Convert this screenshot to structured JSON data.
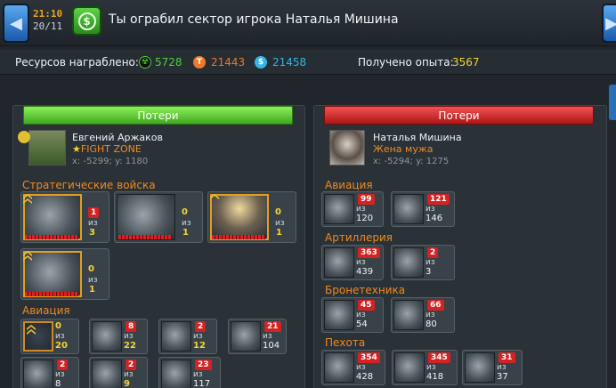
{
  "header": {
    "time": "21:10",
    "date": "20/11",
    "title": "Ты ограбил сектор игрока Наталья Мишина"
  },
  "resources": {
    "label": "Ресурсов награблено:",
    "items": [
      {
        "icon": "radiation-icon",
        "value": "5728",
        "color": "#4fcf3a"
      },
      {
        "icon": "t-coin-icon",
        "value": "21443",
        "color": "#f0782a"
      },
      {
        "icon": "dollar-icon",
        "value": "21458",
        "color": "#35b5e8"
      }
    ],
    "exp_label": "Получено опыта:",
    "exp_value": "3567"
  },
  "left": {
    "header": "Потери",
    "player": {
      "name": "Евгений Аржаков",
      "clan": "FIGHT ZONE",
      "coords": "x: -5299; y: 1180"
    },
    "sections": [
      {
        "title": "Стратегические войска",
        "units": [
          {
            "count": "1",
            "of": "из",
            "total": "3"
          },
          {
            "count": "0",
            "of": "из",
            "total": "1"
          },
          {
            "count": "0",
            "of": "из",
            "total": "1"
          },
          {
            "count": "0",
            "of": "из",
            "total": "1"
          }
        ]
      },
      {
        "title": "Авиация",
        "units": [
          {
            "count": "0",
            "of": "из",
            "total": "20"
          },
          {
            "count": "8",
            "of": "из",
            "total": "22"
          },
          {
            "count": "2",
            "of": "из",
            "total": "12"
          },
          {
            "count": "21",
            "of": "из",
            "total": "104"
          },
          {
            "count": "2",
            "of": "из",
            "total": "8"
          },
          {
            "count": "2",
            "of": "из",
            "total": "9"
          },
          {
            "count": "23",
            "of": "из",
            "total": "117"
          }
        ]
      }
    ]
  },
  "right": {
    "header": "Потери",
    "player": {
      "name": "Наталья Мишина",
      "clan": "Жена мужа",
      "coords": "x: -5294; y: 1275"
    },
    "sections": [
      {
        "title": "Авиация",
        "units": [
          {
            "count": "99",
            "of": "из",
            "total": "120"
          },
          {
            "count": "121",
            "of": "из",
            "total": "146"
          }
        ]
      },
      {
        "title": "Артиллерия",
        "units": [
          {
            "count": "363",
            "of": "из",
            "total": "439"
          },
          {
            "count": "2",
            "of": "из",
            "total": "3"
          }
        ]
      },
      {
        "title": "Бронетехника",
        "units": [
          {
            "count": "45",
            "of": "из",
            "total": "54"
          },
          {
            "count": "66",
            "of": "из",
            "total": "80"
          }
        ]
      },
      {
        "title": "Пехота",
        "units": [
          {
            "count": "354",
            "of": "из",
            "total": "428"
          },
          {
            "count": "345",
            "of": "из",
            "total": "418"
          },
          {
            "count": "31",
            "of": "из",
            "total": "37"
          }
        ]
      }
    ]
  }
}
